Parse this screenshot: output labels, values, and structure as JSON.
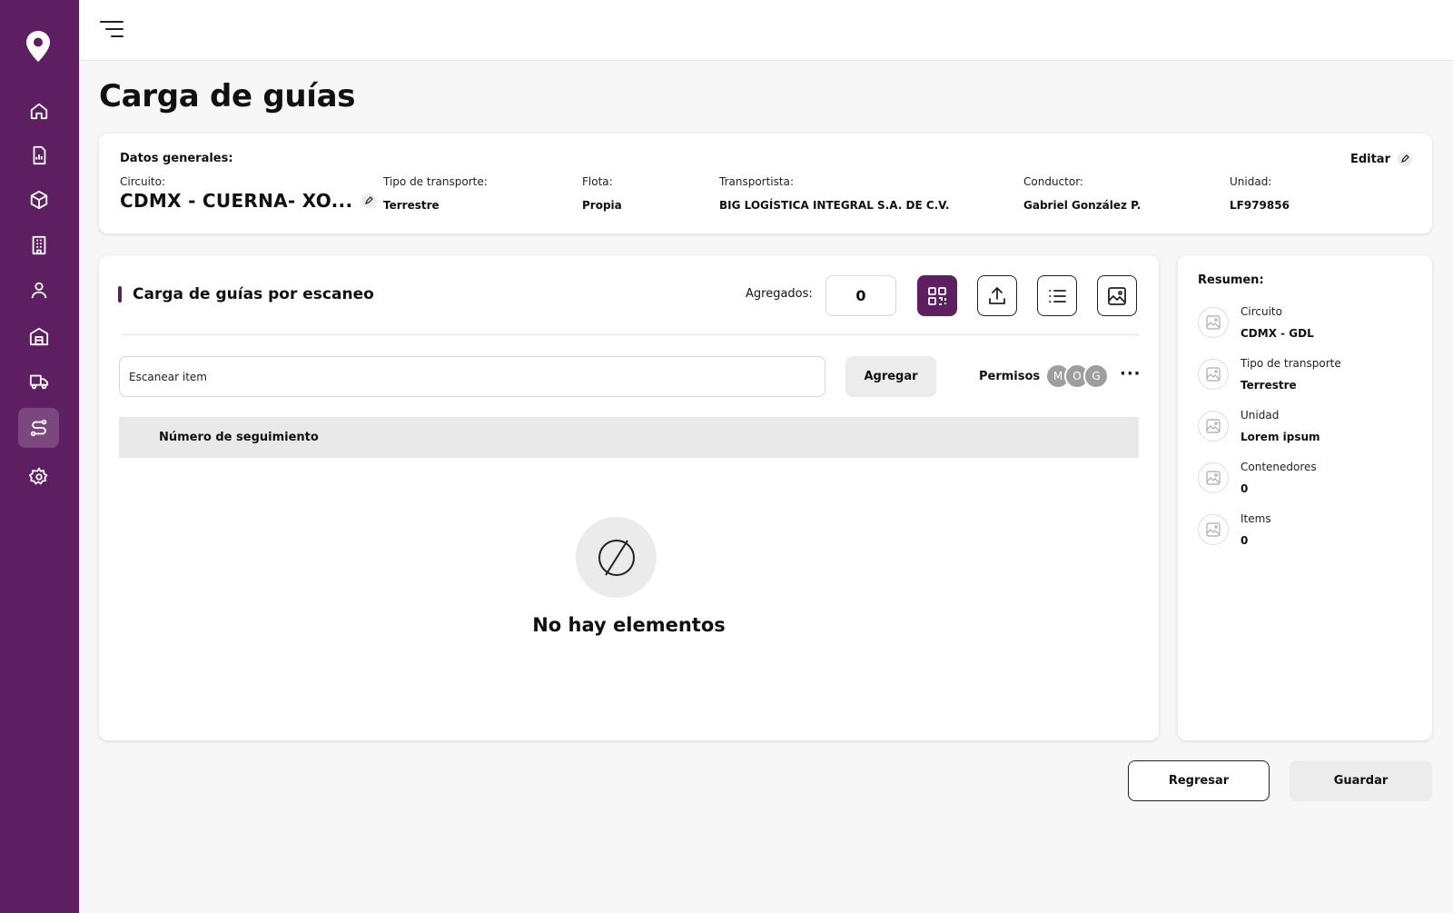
{
  "sidebar": {
    "color": "#5e1f62",
    "logo_icon": "map-pin-icon",
    "items": [
      {
        "icon": "home-icon",
        "active": false
      },
      {
        "icon": "report-icon",
        "active": false
      },
      {
        "icon": "box-icon",
        "active": false
      },
      {
        "icon": "building-icon",
        "active": false
      },
      {
        "icon": "user-icon",
        "active": false
      },
      {
        "icon": "warehouse-icon",
        "active": false
      },
      {
        "icon": "truck-icon",
        "active": false
      },
      {
        "icon": "route-icon",
        "active": true
      },
      {
        "icon": "gear-icon",
        "active": false
      }
    ]
  },
  "topbar": {
    "menu_icon": "hamburger-menu-icon"
  },
  "page": {
    "title": "Carga de guías"
  },
  "general": {
    "heading": "Datos generales:",
    "edit_label": "Editar",
    "circuito": {
      "label": "Circuito:",
      "value": "CDMX - CUERNA- XO..."
    },
    "tipo_transporte": {
      "label": "Tipo de transporte:",
      "value": "Terrestre"
    },
    "flota": {
      "label": "Flota:",
      "value": "Propia"
    },
    "transportista": {
      "label": "Transportista:",
      "value": "BIG LOGÍSTICA INTEGRAL S.A. DE C.V."
    },
    "conductor": {
      "label": "Conductor:",
      "value": "Gabriel González P."
    },
    "unidad": {
      "label": "Unidad:",
      "value": "LF979856"
    }
  },
  "scan": {
    "title": "Carga de guías por escaneo",
    "agregados_label": "Agregados:",
    "agregados_value": "0",
    "tools": [
      "qr-code-icon",
      "upload-icon",
      "list-icon",
      "image-icon"
    ],
    "input_value": "Escanear item",
    "add_label": "Agregar",
    "permisos_label": "Permisos",
    "avatars": [
      "M",
      "O",
      "G"
    ],
    "more_label": "···",
    "column_header": "Número de seguimiento",
    "empty_text": "No hay elementos"
  },
  "summary": {
    "heading": "Resumen:",
    "items": [
      {
        "label": "Circuito",
        "value": "CDMX - GDL"
      },
      {
        "label": "Tipo de transporte",
        "value": "Terrestre"
      },
      {
        "label": "Unidad",
        "value": "Lorem ipsum"
      },
      {
        "label": "Contenedores",
        "value": "0"
      },
      {
        "label": "Items",
        "value": "0"
      }
    ]
  },
  "actions": {
    "back_label": "Regresar",
    "save_label": "Guardar"
  }
}
